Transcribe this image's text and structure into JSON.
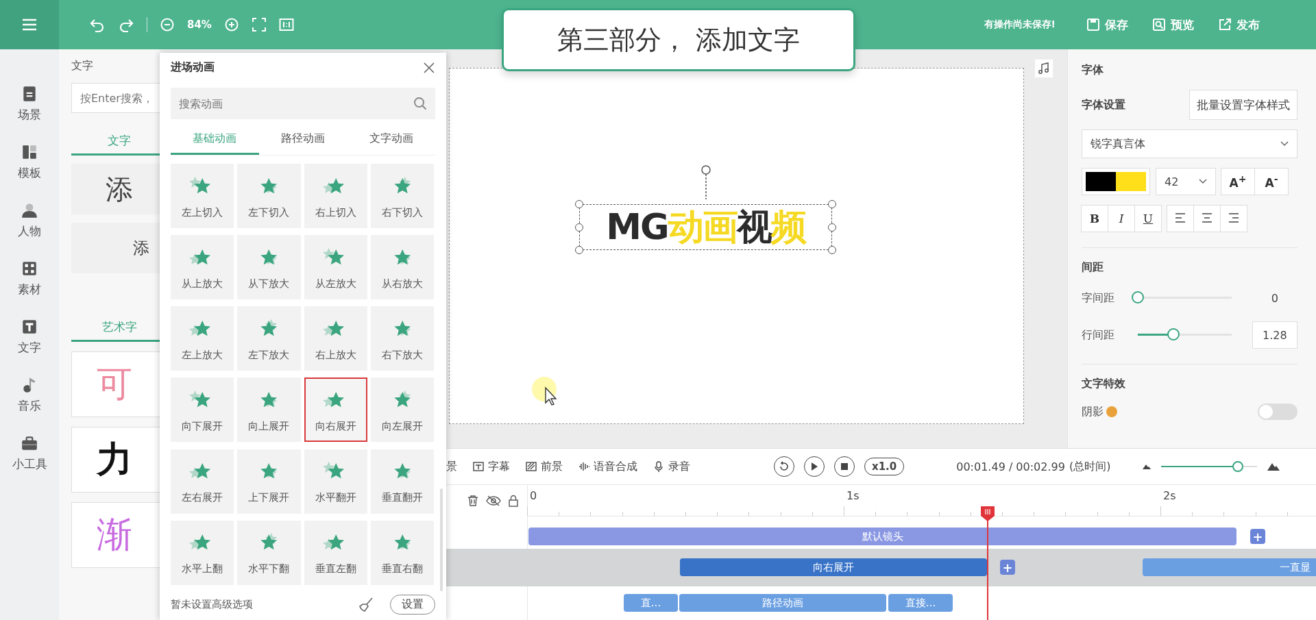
{
  "top_bar": {
    "zoom": "84%",
    "callout": "第三部分， 添加文字",
    "unsaved_notice": "有操作尚未保存!",
    "actions": [
      {
        "label": "保存",
        "kind": "save"
      },
      {
        "label": "预览",
        "kind": "preview"
      },
      {
        "label": "发布",
        "kind": "publish"
      }
    ]
  },
  "sidebar": {
    "items": [
      {
        "label": "场景",
        "kind": "scene",
        "selected": false
      },
      {
        "label": "模板",
        "kind": "template",
        "selected": false
      },
      {
        "label": "人物",
        "kind": "person",
        "selected": false
      },
      {
        "label": "素材",
        "kind": "material",
        "selected": false
      },
      {
        "label": "文字",
        "kind": "text",
        "selected": false
      },
      {
        "label": "音乐",
        "kind": "music",
        "selected": false
      },
      {
        "label": "小工具",
        "kind": "tools",
        "selected": false
      }
    ]
  },
  "text_panel": {
    "title": "文字",
    "search": {
      "placeholder": "按Enter搜索，"
    },
    "tabs": [
      {
        "label": "文字",
        "selected": true
      }
    ],
    "cards": [
      {
        "text": "添",
        "kind": "large"
      },
      {
        "text": "添",
        "kind": "small"
      }
    ],
    "art_tabs": [
      {
        "label": "艺术字",
        "selected": true
      }
    ],
    "art_cards": [
      {
        "text": "可",
        "kind": "cute"
      },
      {
        "text": "力",
        "kind": "power"
      },
      {
        "text": "渐",
        "kind": "gradient"
      }
    ]
  },
  "animation_popup": {
    "title": "进场动画",
    "search": {
      "placeholder": "搜索动画"
    },
    "tabs": [
      {
        "label": "基础动画",
        "selected": true
      },
      {
        "label": "路径动画",
        "selected": false
      },
      {
        "label": "文字动画",
        "selected": false
      }
    ],
    "items": [
      {
        "label": "左上切入",
        "selected": false
      },
      {
        "label": "左下切入",
        "selected": false
      },
      {
        "label": "右上切入",
        "selected": false
      },
      {
        "label": "右下切入",
        "selected": false
      },
      {
        "label": "从上放大",
        "selected": false
      },
      {
        "label": "从下放大",
        "selected": false
      },
      {
        "label": "从左放大",
        "selected": false
      },
      {
        "label": "从右放大",
        "selected": false
      },
      {
        "label": "左上放大",
        "selected": false
      },
      {
        "label": "左下放大",
        "selected": false
      },
      {
        "label": "右上放大",
        "selected": false
      },
      {
        "label": "右下放大",
        "selected": false
      },
      {
        "label": "向下展开",
        "selected": false
      },
      {
        "label": "向上展开",
        "selected": false
      },
      {
        "label": "向右展开",
        "selected": true
      },
      {
        "label": "向左展开",
        "selected": false
      },
      {
        "label": "左右展开",
        "selected": false
      },
      {
        "label": "上下展开",
        "selected": false
      },
      {
        "label": "水平翻开",
        "selected": false
      },
      {
        "label": "垂直翻开",
        "selected": false
      },
      {
        "label": "水平上翻",
        "selected": false
      },
      {
        "label": "水平下翻",
        "selected": false
      },
      {
        "label": "垂直左翻",
        "selected": false
      },
      {
        "label": "垂直右翻",
        "selected": false
      }
    ],
    "footer_text": "暂未设置高级选项",
    "settings_button": "设置"
  },
  "canvas": {
    "title_segments": [
      {
        "text": "MG",
        "color": "#2b2b2b"
      },
      {
        "text": "动画",
        "color": "#f5d923"
      },
      {
        "text": "视",
        "color": "#2b2b2b"
      },
      {
        "text": "频",
        "color": "#f5d923"
      }
    ]
  },
  "properties": {
    "font": {
      "title": "字体",
      "settings_label": "字体设置",
      "batch_button": "批量设置字体样式",
      "font_family": "锐字真言体",
      "colors": [
        {
          "color": "#000000"
        },
        {
          "color": "#ffdf1a"
        }
      ],
      "size": "42",
      "size_buttons": [
        "A$^{+}$",
        "A$^{-}$"
      ],
      "styles": [
        {
          "label": "B",
          "kind": "bold",
          "on": false
        },
        {
          "label": "I",
          "kind": "italic",
          "on": false
        },
        {
          "label": "U",
          "kind": "underline",
          "on": false
        }
      ]
    },
    "spacing": {
      "title": "间距",
      "rows": [
        {
          "label": "字间距",
          "level": 0,
          "value": "0"
        },
        {
          "label": "行间距",
          "level": 0.38,
          "value": "1.28"
        }
      ]
    },
    "effects": {
      "title": "文字特效",
      "rows": [
        {
          "label": "阴影",
          "on": false
        }
      ]
    }
  },
  "timeline": {
    "tools": [
      {
        "label": "景",
        "kind": "scene"
      },
      {
        "label": "字幕",
        "kind": "subtitle"
      },
      {
        "label": "前景",
        "kind": "foreground"
      },
      {
        "label": "语音合成",
        "kind": "tts"
      },
      {
        "label": "录音",
        "kind": "record"
      }
    ],
    "speed": "x1.0",
    "time": "00:01.49 / 00:02.99",
    "total_label": "(总时间)",
    "zoom": {
      "level": 0.8
    },
    "ruler": [
      "0",
      "1s",
      "2s"
    ],
    "tracks": [
      {
        "add_button": "+",
        "clips": [
          {
            "label": "默认镜头",
            "kind": "camera",
            "selected": false
          }
        ]
      },
      {
        "add_button": "+",
        "clips": [
          {
            "label": "向右展开",
            "kind": "animation",
            "selected": true
          },
          {
            "label": "一直显",
            "kind": "animation",
            "selected": false
          }
        ]
      },
      {
        "clips": [
          {
            "label": "直...",
            "kind": "path",
            "selected": false
          },
          {
            "label": "路径动画",
            "kind": "path",
            "selected": false
          },
          {
            "label": "直接...",
            "kind": "path",
            "selected": false
          }
        ]
      }
    ]
  }
}
